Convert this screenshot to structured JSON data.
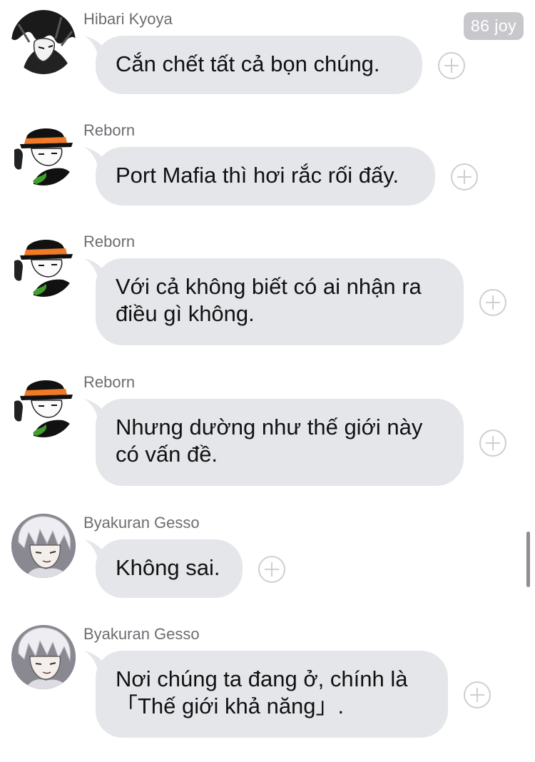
{
  "header": {
    "badge": "86 joy"
  },
  "messages": [
    {
      "sender": "Hibari Kyoya",
      "avatar": "hibari-avatar",
      "text": "Cắn chết tất cả bọn chúng."
    },
    {
      "sender": "Reborn",
      "avatar": "reborn-avatar",
      "text": "Port Mafia thì hơi rắc rối đấy."
    },
    {
      "sender": "Reborn",
      "avatar": "reborn-avatar",
      "text": "Với cả không biết có ai nhận ra\nđiều gì không."
    },
    {
      "sender": "Reborn",
      "avatar": "reborn-avatar",
      "text": "Nhưng dường như thế giới này\ncó vấn đề."
    },
    {
      "sender": "Byakuran Gesso",
      "avatar": "byakuran-avatar",
      "text": "Không sai."
    },
    {
      "sender": "Byakuran Gesso",
      "avatar": "byakuran-avatar",
      "text": "Nơi chúng ta đang ở, chính là\n「Thế giới khả năng」."
    }
  ],
  "colors": {
    "bubble": "#e5e6ea",
    "sender": "#6d6d72",
    "badge": "#c8c8cc",
    "react_icon": "#cfcfd3"
  },
  "icons": {
    "react": "add-reaction-icon"
  }
}
